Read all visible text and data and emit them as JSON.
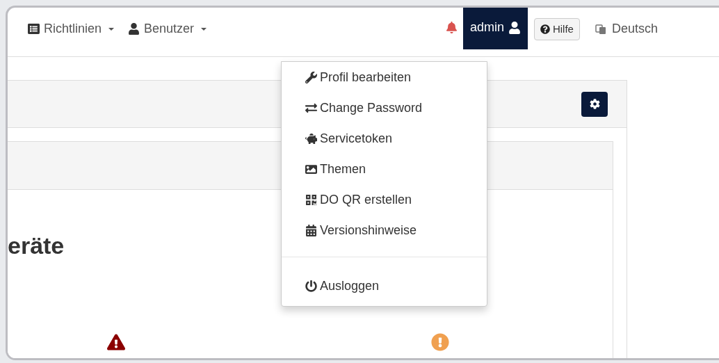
{
  "nav": {
    "menus": [
      {
        "label": "Richtlinien"
      },
      {
        "label": "Benutzer"
      }
    ],
    "user": {
      "label": "admin",
      "expanded": true
    },
    "help_button": "Hilfe",
    "language": "Deutsch"
  },
  "user_menu": {
    "sections": [
      [
        {
          "label": "Profil bearbeiten"
        },
        {
          "label": "Change Password"
        },
        {
          "label": "Servicetoken"
        },
        {
          "label": "Themen"
        },
        {
          "label": "DO QR erstellen"
        },
        {
          "label": "Versionshinweise"
        }
      ],
      [
        {
          "label": "Ausloggen"
        }
      ]
    ]
  },
  "page": {
    "heading": "eräte",
    "status_icons": [
      {
        "kind": "warning",
        "color": "#8b0000"
      },
      {
        "kind": "info",
        "color": "#f0a050"
      }
    ]
  }
}
